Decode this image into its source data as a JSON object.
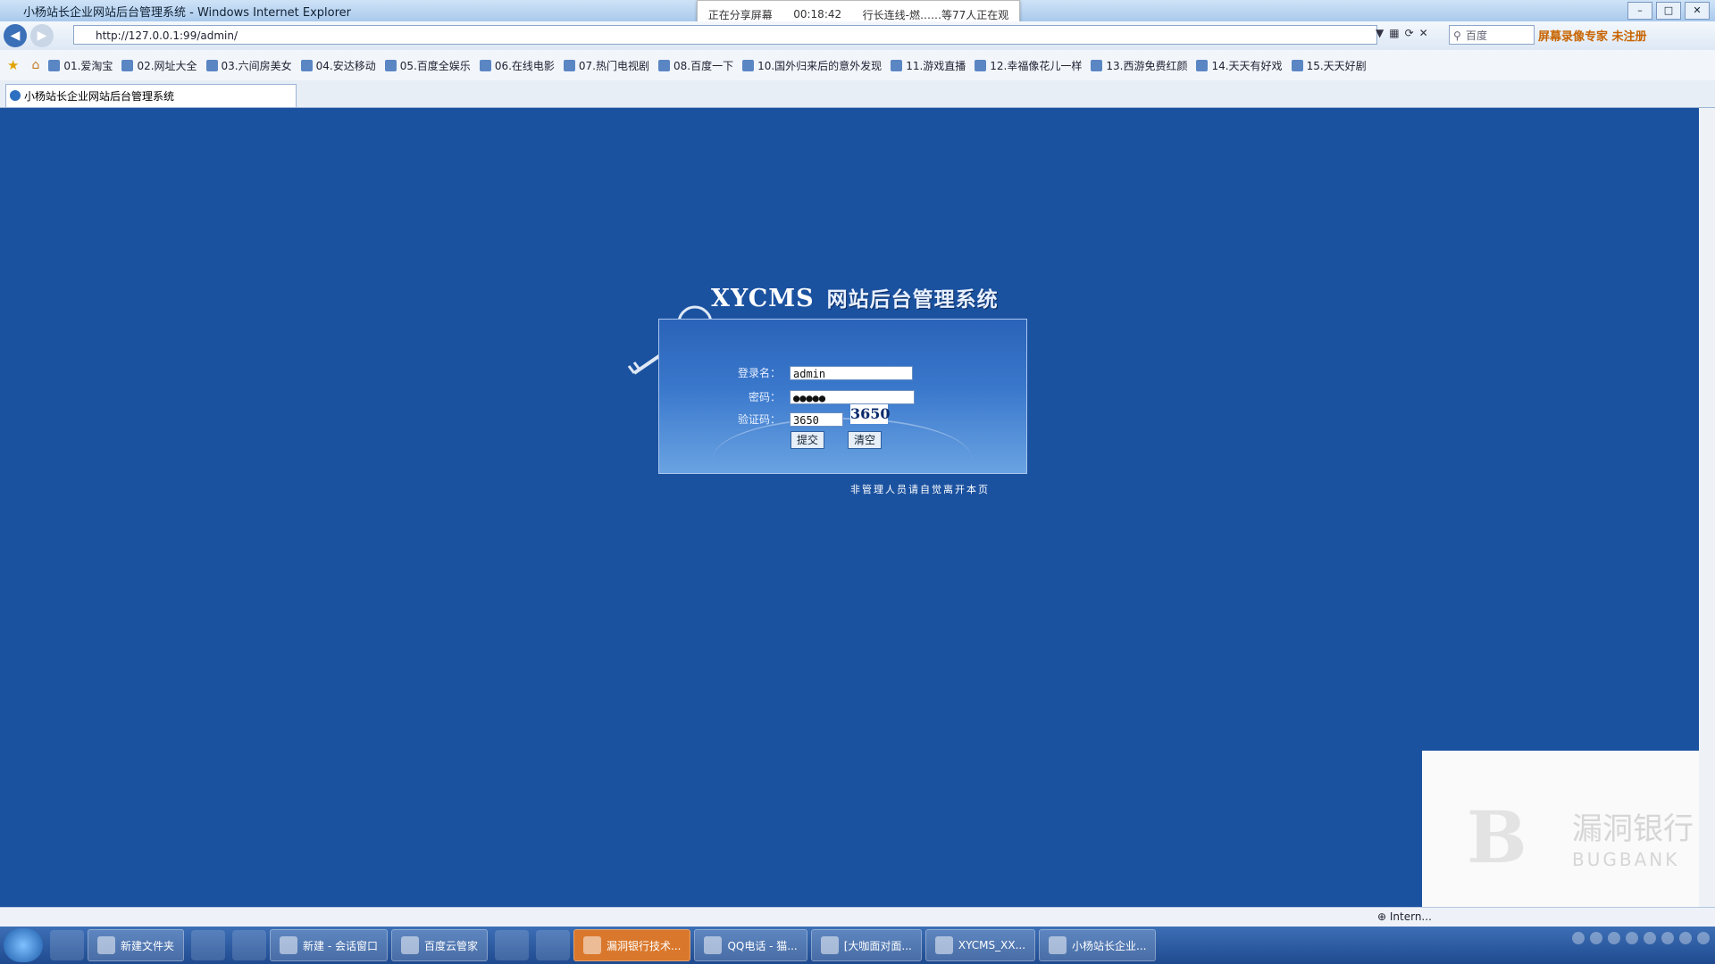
{
  "window": {
    "title": "小杨站长企业网站后台管理系统 - Windows Internet Explorer"
  },
  "share": {
    "status": "正在分享屏幕",
    "time": "00:18:42",
    "viewers": "行长连线-燃……等77人正在观"
  },
  "browser": {
    "url": "http://127.0.0.1:99/admin/",
    "search_placeholder": "百度",
    "toolbar_right": "屏幕录像专家 未注册"
  },
  "favorites": [
    "01.爱淘宝",
    "02.网址大全",
    "03.六间房美女",
    "04.安达移动",
    "05.百度全娱乐",
    "06.在线电影",
    "07.热门电视剧",
    "08.百度一下",
    "10.国外归来后的意外发现",
    "11.游戏直播",
    "12.幸福像花儿一样",
    "13.西游免费红颜",
    "14.天天有好戏",
    "15.天天好剧"
  ],
  "tab": {
    "label": "小杨站长企业网站后台管理系统"
  },
  "login": {
    "brand": "XYCMS",
    "subtitle": "网站后台管理系统",
    "username_label": "登录名：",
    "username_value": "admin",
    "password_label": "密码：",
    "password_value": "●●●●●",
    "captcha_label": "验证码：",
    "captcha_value": "3650",
    "captcha_image_text": "3650",
    "submit_label": "提交",
    "reset_label": "清空",
    "notice": "非管理人员请自觉离开本页"
  },
  "watermark": {
    "name": "漏洞银行",
    "sub": "BUGBANK"
  },
  "status": {
    "zone": "Intern..."
  },
  "taskbar": {
    "tasks": [
      {
        "label": "新建文件夹",
        "active": false
      },
      {
        "label": "新建 - 会话窗口",
        "active": false
      },
      {
        "label": "百度云管家",
        "active": false
      },
      {
        "label": "漏洞银行技术...",
        "active": true
      },
      {
        "label": "QQ电话 - 猫...",
        "active": false
      },
      {
        "label": "[大咖面对面...",
        "active": false
      },
      {
        "label": "XYCMS_XX...",
        "active": false
      },
      {
        "label": "小杨站长企业...",
        "active": false
      }
    ]
  }
}
